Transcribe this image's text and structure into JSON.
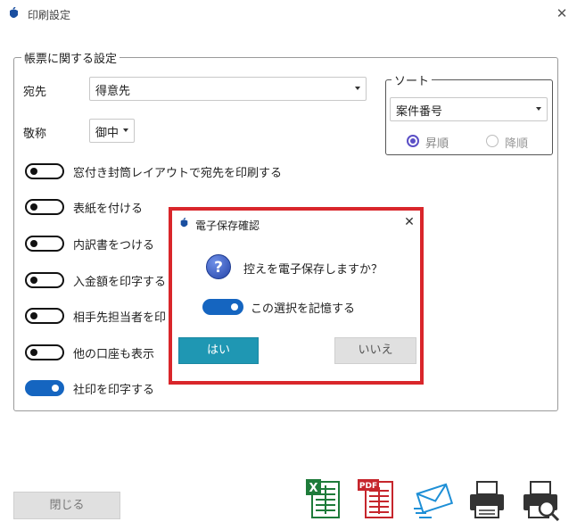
{
  "window": {
    "title": "印刷設定",
    "close_glyph": "✕"
  },
  "group": {
    "title": "帳票に関する設定",
    "destination": {
      "label": "宛先",
      "value": "得意先"
    },
    "honorific": {
      "label": "敬称",
      "value": "御中"
    },
    "toggles": [
      {
        "label": "窓付き封筒レイアウトで宛先を印刷する",
        "on": false
      },
      {
        "label": "表紙を付ける",
        "on": false
      },
      {
        "label": "内訳書をつける",
        "on": false
      },
      {
        "label": "入金額を印字する",
        "on": false
      },
      {
        "label": "相手先担当者を印",
        "on": false
      },
      {
        "label": "他の口座も表示",
        "on": false
      },
      {
        "label": "社印を印字する",
        "on": true
      }
    ]
  },
  "sort": {
    "title": "ソート",
    "value": "案件番号",
    "options": [
      {
        "label": "昇順",
        "selected": true
      },
      {
        "label": "降順",
        "selected": false
      }
    ]
  },
  "footer": {
    "close_label": "閉じる",
    "tools": [
      "excel-icon",
      "pdf-icon",
      "mail-icon",
      "printer-icon",
      "print-preview-icon"
    ]
  },
  "dialog": {
    "title": "電子保存確認",
    "close_glyph": "✕",
    "question_glyph": "?",
    "message": "控えを電子保存しますか？",
    "remember_label": "この選択を記憶する",
    "remember_on": true,
    "yes_label": "はい",
    "no_label": "いいえ"
  },
  "colors": {
    "accent": "#1565c0",
    "dialog_border": "#d9262b",
    "yes_button": "#1f97b3",
    "radio": "#5b4fc6"
  }
}
